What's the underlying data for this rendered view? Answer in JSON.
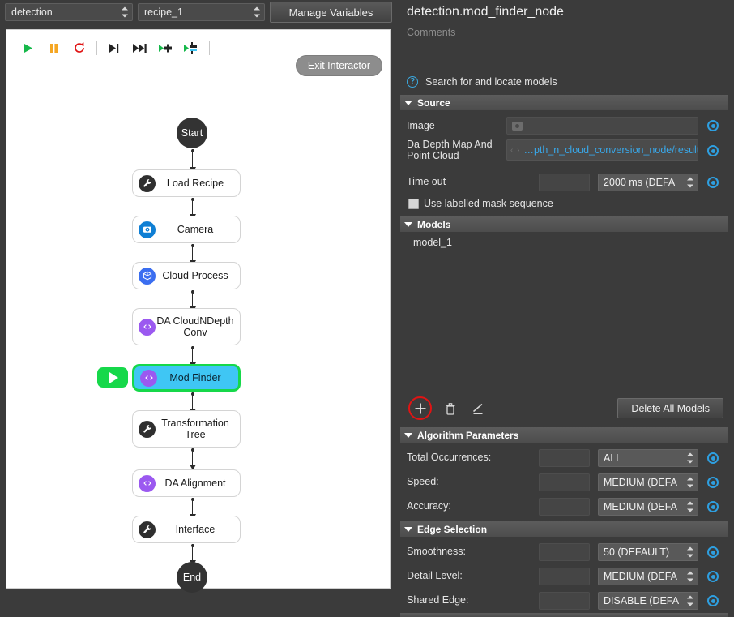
{
  "topbar": {
    "project_select": "detection",
    "recipe_select": "recipe_1",
    "manage_variables_label": "Manage Variables"
  },
  "toolbar": {
    "buttons": [
      {
        "name": "run",
        "icon": "play-icon"
      },
      {
        "name": "pause",
        "icon": "pause-icon"
      },
      {
        "name": "reset",
        "icon": "reload-icon"
      },
      {
        "name": "step-next",
        "icon": "step-forward-icon"
      },
      {
        "name": "run-to-end",
        "icon": "fast-forward-icon"
      },
      {
        "name": "run-from-node",
        "icon": "run-node-icon"
      },
      {
        "name": "run-single-node",
        "icon": "run-single-node-icon"
      }
    ],
    "exit_interactor_label": "Exit Interactor"
  },
  "graph": {
    "start_label": "Start",
    "end_label": "End",
    "nodes": [
      {
        "label": "Load Recipe",
        "icon": "wrench-icon",
        "icon_color": "#2f2f2f",
        "selected": false
      },
      {
        "label": "Camera",
        "icon": "camera-icon",
        "icon_color": "#0f7fd4",
        "selected": false
      },
      {
        "label": "Cloud Process",
        "icon": "cube-icon",
        "icon_color": "#3b6ef0",
        "selected": false
      },
      {
        "label": "DA CloudNDepth Conv",
        "icon": "code-icon",
        "icon_color": "#9b59f0",
        "selected": false
      },
      {
        "label": "Mod Finder",
        "icon": "code-icon",
        "icon_color": "#9b59f0",
        "selected": true
      },
      {
        "label": "Transformation Tree",
        "icon": "wrench-icon",
        "icon_color": "#2f2f2f",
        "selected": false
      },
      {
        "label": "DA Alignment",
        "icon": "code-icon",
        "icon_color": "#9b59f0",
        "selected": false
      },
      {
        "label": "Interface",
        "icon": "wrench-icon",
        "icon_color": "#2f2f2f",
        "selected": false
      }
    ],
    "selection_border_color": "#16d84a",
    "selection_fill_color": "#3fc6f4",
    "run_node_button_color": "#16d84a"
  },
  "panel": {
    "node_title": "detection.mod_finder_node",
    "comments_placeholder": "Comments",
    "hint_text": "Search for and locate models",
    "sections": {
      "source": {
        "title": "Source",
        "rows": [
          {
            "label": "Image",
            "value": "",
            "type": "image-field"
          },
          {
            "label": "Da Depth Map And Point Cloud",
            "value": "…pth_n_cloud_conversion_node/result",
            "type": "link-field"
          },
          {
            "label": "Time out",
            "value": "",
            "select": "2000 ms (DEFA",
            "type": "select-row"
          }
        ],
        "checkbox_label": "Use labelled mask sequence",
        "checkbox_checked": false
      },
      "models": {
        "title": "Models",
        "items": [
          "model_1"
        ],
        "tools": [
          {
            "name": "add-model",
            "icon": "plus-icon",
            "highlighted": true
          },
          {
            "name": "delete-model",
            "icon": "trash-icon",
            "highlighted": false
          },
          {
            "name": "edit-model",
            "icon": "pencil-icon",
            "highlighted": false
          }
        ],
        "delete_all_label": "Delete All Models",
        "highlight_color": "#e01414"
      },
      "algorithm_parameters": {
        "title": "Algorithm Parameters",
        "rows": [
          {
            "label": "Total Occurrences:",
            "value": "",
            "select": "ALL"
          },
          {
            "label": "Speed:",
            "value": "",
            "select": "MEDIUM (DEFA"
          },
          {
            "label": "Accuracy:",
            "value": "",
            "select": "MEDIUM (DEFA"
          }
        ]
      },
      "edge_selection": {
        "title": "Edge Selection",
        "rows": [
          {
            "label": "Smoothness:",
            "value": "",
            "select": "50 (DEFAULT)"
          },
          {
            "label": "Detail Level:",
            "value": "",
            "select": "MEDIUM (DEFA"
          },
          {
            "label": "Shared Edge:",
            "value": "",
            "select": "DISABLE (DEFA"
          }
        ]
      }
    }
  },
  "colors": {
    "panel_bg": "#3b3b3b",
    "section_header": "#565656",
    "accent_blue": "#2e9fe0",
    "link_blue": "#39a7e8"
  }
}
